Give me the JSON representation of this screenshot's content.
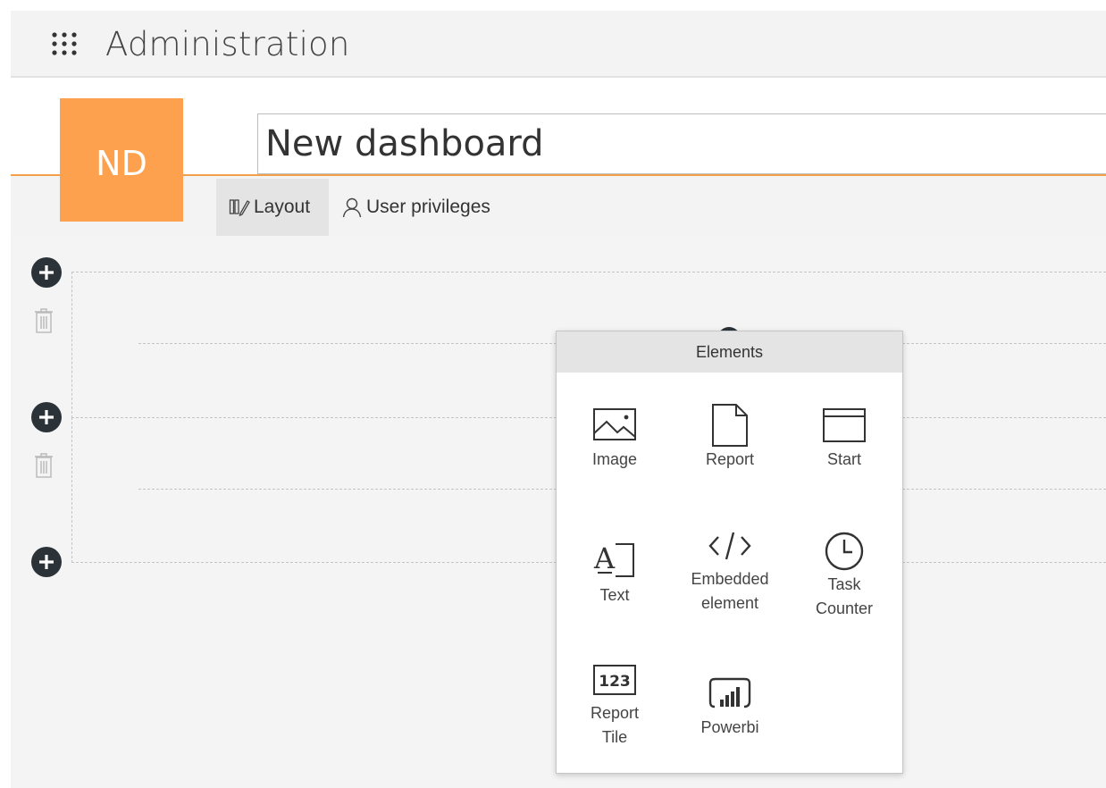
{
  "app": {
    "title": "Administration",
    "menu_icon": "waffle-grid-icon"
  },
  "dashboard": {
    "initials": "ND",
    "name_value": "New dashboard",
    "accent_color": "#fda14e",
    "line_color": "#f4a04a"
  },
  "tabs": [
    {
      "label": "Layout",
      "icon": "layout-icon",
      "active": true
    },
    {
      "label": "User privileges",
      "icon": "user-icon",
      "active": false
    }
  ],
  "rows": [
    {
      "add_icon": "add-row-icon",
      "delete_icon": "trash-icon"
    },
    {
      "add_icon": "add-row-icon",
      "delete_icon": "trash-icon"
    },
    {
      "add_icon": "add-row-icon"
    }
  ],
  "elements_menu": {
    "title": "Elements",
    "items": [
      {
        "label": "Image",
        "icon": "image-icon"
      },
      {
        "label": "Report",
        "icon": "report-icon"
      },
      {
        "label": "Start",
        "icon": "start-icon"
      },
      {
        "label": "Text",
        "icon": "text-icon"
      },
      {
        "label": "Embedded element",
        "icon": "code-icon"
      },
      {
        "label": "Task Counter",
        "icon": "clock-icon"
      },
      {
        "label": "Report Tile",
        "icon": "number-tile-icon"
      },
      {
        "label": "Powerbi",
        "icon": "powerbi-icon"
      }
    ]
  }
}
